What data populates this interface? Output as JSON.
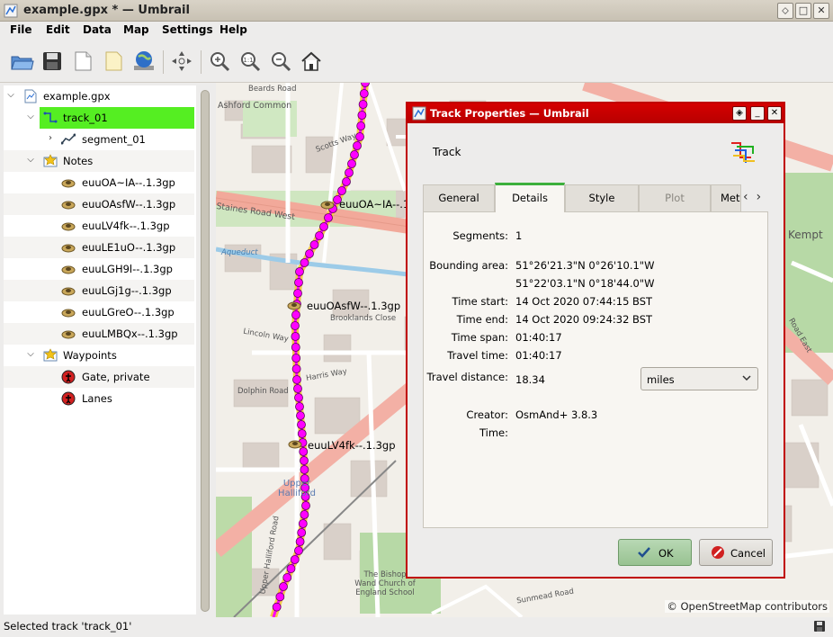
{
  "window": {
    "title": "example.gpx * — Umbrail"
  },
  "menu": [
    "File",
    "Edit",
    "Data",
    "Map",
    "Settings",
    "Help"
  ],
  "toolbar_icons": [
    "open-icon",
    "save-icon",
    "new-note-icon",
    "paste-icon",
    "download-map-icon",
    "pan-icon",
    "zoom-in-icon",
    "zoom-actual-icon",
    "zoom-out-icon",
    "home-icon"
  ],
  "tree": {
    "file": "example.gpx",
    "track": "track_01",
    "segment": "segment_01",
    "notes_label": "Notes",
    "notes": [
      "euuOA~IA--.1.3gp",
      "euuOAsfW--.1.3gp",
      "euuLV4fk--.1.3gp",
      "euuLE1uO--.1.3gp",
      "euuLGH9l--.1.3gp",
      "euuLGj1g--.1.3gp",
      "euuLGreO--.1.3gp",
      "euuLMBQx--.1.3gp"
    ],
    "waypoints_label": "Waypoints",
    "waypoints": [
      "Gate, private",
      "Lanes"
    ]
  },
  "map": {
    "attribution": "© OpenStreetMap contributors",
    "labels": {
      "beards_road": "Beards Road",
      "ashford_common": "Ashford Common",
      "scotts_way": "Scotts Way",
      "staines_road_west": "Staines Road West",
      "aqueduct": "Aqueduct",
      "brooklands_close": "Brooklands Close",
      "lincoln_way": "Lincoln Way",
      "harris_way": "Harris Way",
      "dolphin_road": "Dolphin Road",
      "upper_halliford": "Upper Halliford",
      "upper_halliford_road": "Upper Halliford Road",
      "bishop_wand_school": "The Bishop Wand Church of England School",
      "kempton": "Kempt",
      "sunmead_road": "Sunmead Road",
      "road_east": "Road East"
    },
    "note_labels": [
      "euuOA~IA--.1.3gp",
      "euuOAsfW--.1.3gp",
      "euuLV4fk--.1.3gp"
    ]
  },
  "status": {
    "text": "Selected track 'track_01'"
  },
  "dialog": {
    "title": "Track Properties — Umbrail",
    "heading": "Track",
    "tabs": [
      "General",
      "Details",
      "Style",
      "Plot",
      "Met"
    ],
    "active_tab": "Details",
    "details": {
      "segments_label": "Segments:",
      "segments": "1",
      "bbox_label": "Bounding area:",
      "bbox_line1": "51°26'21.3\"N   0°26'10.1\"W",
      "bbox_line2": "51°22'03.1\"N   0°18'44.0\"W",
      "time_start_label": "Time start:",
      "time_start": "14 Oct 2020 07:44:15 BST",
      "time_end_label": "Time end:",
      "time_end": "14 Oct 2020 09:24:32 BST",
      "time_span_label": "Time span:",
      "time_span": "01:40:17",
      "travel_time_label": "Travel time:",
      "travel_time": "01:40:17",
      "travel_distance_label": "Travel distance:",
      "travel_distance": "18.34",
      "distance_unit": "miles",
      "creator_label": "Creator:",
      "creator": "OsmAnd+ 3.8.3",
      "time_label": "Time:",
      "time": ""
    },
    "ok_label": "OK",
    "cancel_label": "Cancel"
  },
  "colors": {
    "track": "#ff00ff",
    "selection": "#55ee22",
    "dialog_border": "#c00000"
  }
}
